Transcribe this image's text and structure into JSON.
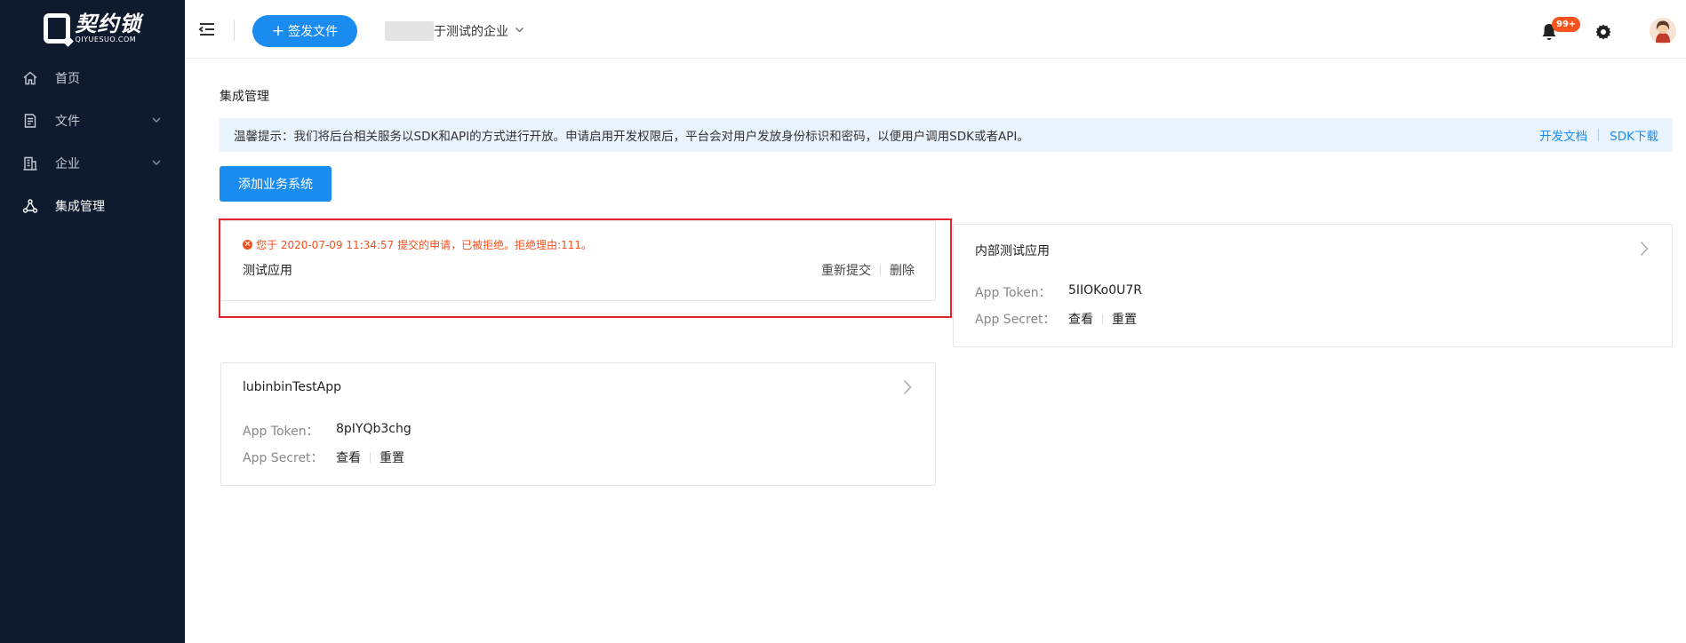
{
  "logo": {
    "cn": "契约锁",
    "en": "QIYUESUO.COM"
  },
  "sidebar": {
    "items": [
      {
        "label": "首页",
        "icon": "home-icon"
      },
      {
        "label": "文件",
        "icon": "file-icon",
        "expandable": true
      },
      {
        "label": "企业",
        "icon": "building-icon",
        "expandable": true
      },
      {
        "label": "集成管理",
        "icon": "network-icon",
        "active": true
      }
    ]
  },
  "header": {
    "sign_button": "签发文件",
    "sign_button_plus": "+",
    "company_name": "于测试的企业",
    "notification_badge": "99+",
    "icons": {
      "menu": "menu-fold-icon",
      "bell": "bell-icon",
      "settings": "gear-icon",
      "avatar": "avatar"
    }
  },
  "main": {
    "title": "集成管理",
    "tip": "温馨提示：我们将后台相关服务以SDK和API的方式进行开放。申请启用开发权限后，平台会对用户发放身份标识和密码，以便用户调用SDK或者API。",
    "tip_links": {
      "docs": "开发文档",
      "sdk": "SDK下载"
    },
    "add_button": "添加业务系统",
    "rejected_app": {
      "message": "您于 2020-07-09 11:34:57 提交的申请，已被拒绝。拒绝理由:111。",
      "name": "测试应用",
      "resubmit": "重新提交",
      "delete": "删除"
    },
    "apps": [
      {
        "name": "内部测试应用",
        "token_label": "App Token：",
        "token": "5IIOKo0U7R",
        "secret_label": "App Secret：",
        "view": "查看",
        "reset": "重置"
      },
      {
        "name": "lubinbinTestApp",
        "token_label": "App Token：",
        "token": "8pIYQb3chg",
        "secret_label": "App Secret：",
        "view": "查看",
        "reset": "重置"
      }
    ]
  },
  "colors": {
    "sidebar_bg": "#0e1a2e",
    "primary": "#1a8cf0",
    "error": "#f4511e",
    "highlight": "#e2262e",
    "tip_bg": "#eaf4ff"
  }
}
